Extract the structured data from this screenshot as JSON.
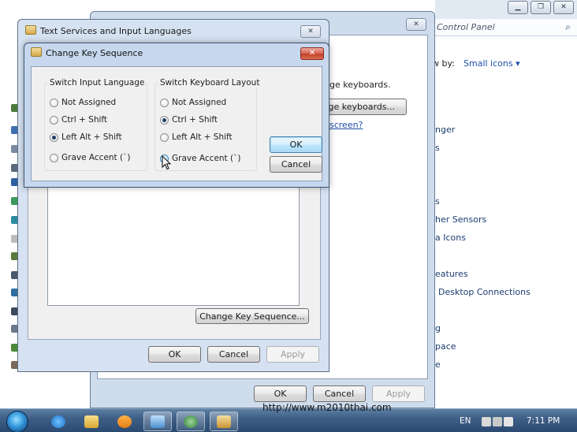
{
  "control_panel": {
    "address": "Control Panel",
    "view_by_label": "w by:",
    "view_by_value": "Small icons ▾",
    "items": [
      {
        "label": "nger"
      },
      {
        "label": "s"
      },
      {
        "label": "s"
      },
      {
        "label": "her Sensors"
      },
      {
        "label": "a Icons"
      },
      {
        "label": "eatures"
      },
      {
        "label": "Desktop Connections"
      },
      {
        "label": "g"
      },
      {
        "label": "pace"
      },
      {
        "label": "e"
      }
    ],
    "inner_text": "ge keyboards.",
    "inner_button": "ge keyboards...",
    "inner_link": "screen?",
    "ok": "OK",
    "cancel": "Cancel",
    "apply": "Apply"
  },
  "text_services": {
    "title": "Text Services and Input Languages",
    "change_key_sequence": "Change Key Sequence...",
    "ok": "OK",
    "cancel": "Cancel",
    "apply": "Apply"
  },
  "change_key": {
    "title": "Change Key Sequence",
    "input_group": {
      "label": "Switch Input Language",
      "options": [
        {
          "label": "Not Assigned",
          "checked": false
        },
        {
          "label": "Ctrl + Shift",
          "checked": false
        },
        {
          "label": "Left Alt + Shift",
          "checked": true
        },
        {
          "label": "Grave Accent (`)",
          "checked": false
        }
      ]
    },
    "layout_group": {
      "label": "Switch Keyboard Layout",
      "options": [
        {
          "label": "Not Assigned",
          "checked": false
        },
        {
          "label": "Ctrl + Shift",
          "checked": true
        },
        {
          "label": "Left Alt + Shift",
          "checked": false
        },
        {
          "label": "Grave Accent (`)",
          "checked": false
        }
      ]
    },
    "ok": "OK",
    "cancel": "Cancel"
  },
  "taskbar": {
    "language": "EN",
    "clock": "7:11 PM"
  },
  "watermark": "http://www.m2010thai.com",
  "icons": [
    "start-orb-icon",
    "internet-explorer-icon",
    "explorer-folder-icon",
    "media-player-icon",
    "remote-desktop-icon",
    "network-icon",
    "keyboard-settings-icon"
  ]
}
